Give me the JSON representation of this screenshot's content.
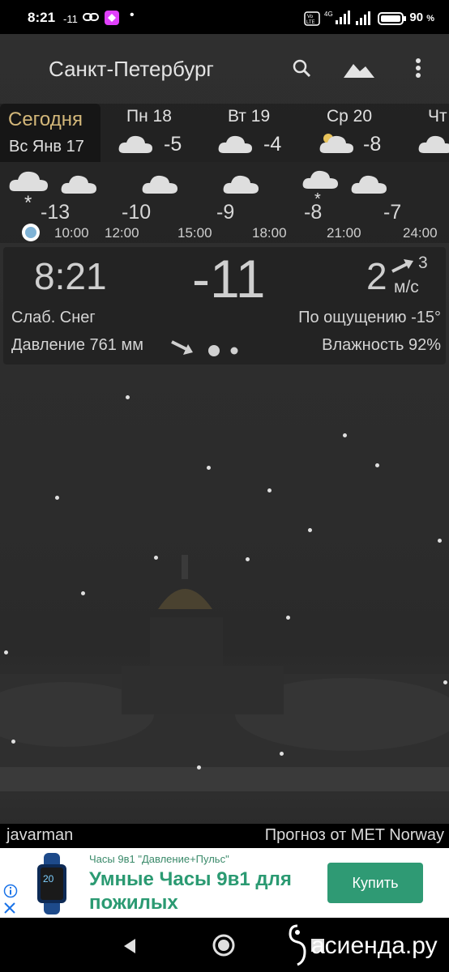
{
  "status_bar": {
    "time": "8:21",
    "temp": "-11",
    "battery": "90"
  },
  "app": {
    "city": "Санкт-Петербург"
  },
  "days": [
    {
      "name": "Сегодня",
      "date": "Вс Янв 17"
    },
    {
      "name": "Пн 18",
      "temp": "-5"
    },
    {
      "name": "Вт 19",
      "temp": "-4"
    },
    {
      "name": "Ср 20",
      "temp": "-8"
    },
    {
      "name": "Чт"
    }
  ],
  "hourly": {
    "temps": [
      "-13",
      "-10",
      "-9",
      "-8",
      "-7"
    ],
    "times": [
      "10:00",
      "12:00",
      "15:00",
      "18:00",
      "21:00",
      "24:00"
    ]
  },
  "current": {
    "time": "8:21",
    "temp": "-11",
    "wind_speed": "2",
    "wind_gust": "3",
    "wind_unit": "м/с",
    "condition": "Слаб. Снег",
    "feels_like": "По ощущению -15°",
    "pressure": "Давление 761 мм",
    "humidity": "Влажность 92%"
  },
  "footer": {
    "author": "javarman",
    "source": "Прогноз от MET Norway"
  },
  "ad": {
    "small": "Часы 9в1 \"Давление+Пульс\"",
    "headline": "Умные Часы 9в1 для пожилых",
    "button": "Купить",
    "watch_screen": "20"
  },
  "watermark": "асиенда.ру"
}
